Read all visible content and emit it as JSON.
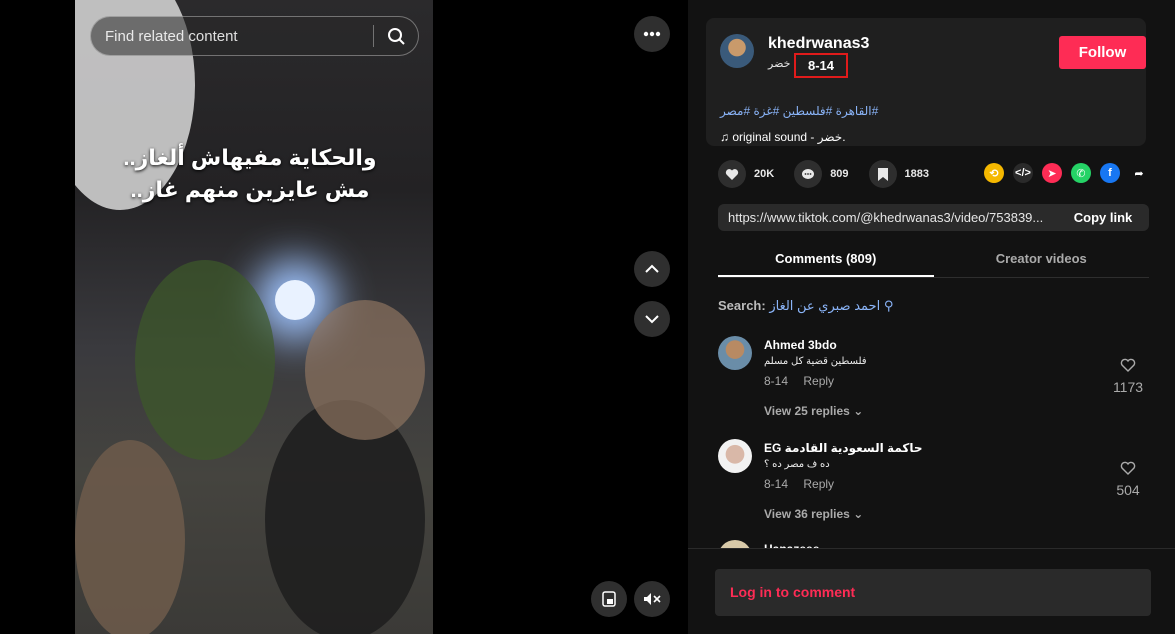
{
  "player": {
    "search_placeholder": "Find related content",
    "caption_line1": "والحكاية مفيهاش ألغاز..",
    "caption_line2": "مش عايزين منهم غاز.."
  },
  "author": {
    "username": "khedrwanas3",
    "nickname": "خضر",
    "separator": "·",
    "date": "8-14",
    "follow_label": "Follow"
  },
  "description": {
    "hashtags": "#القاهرة #فلسطين #غزة #مصر",
    "sound": "original sound - خضر."
  },
  "stats": {
    "likes": "20K",
    "comments": "809",
    "saves": "1883"
  },
  "link": {
    "url": "https://www.tiktok.com/@khedrwanas3/video/753839...",
    "copy_label": "Copy link"
  },
  "tabs": [
    {
      "label": "Comments (809)"
    },
    {
      "label": "Creator videos"
    }
  ],
  "comment_search": {
    "prefix": "Search:",
    "query": "احمد صبري عن الغاز"
  },
  "comments": [
    {
      "name": "Ahmed 3bdo",
      "text": "فلسطين قضية كل مسلم",
      "date": "8-14",
      "reply": "Reply",
      "likes": "1173",
      "view_replies": "View 25 replies"
    },
    {
      "name": "حاكمة السعودية القادمة EG",
      "text": "ده ف مصر ده ؟",
      "date": "8-14",
      "reply": "Reply",
      "likes": "504",
      "view_replies": "View 36 replies"
    },
    {
      "name": "Hanazeee"
    }
  ],
  "login_label": "Log in to comment",
  "colors": {
    "accent": "#fe2c55",
    "link": "#8ab4f8",
    "highlight_box": "#e01b1b"
  }
}
